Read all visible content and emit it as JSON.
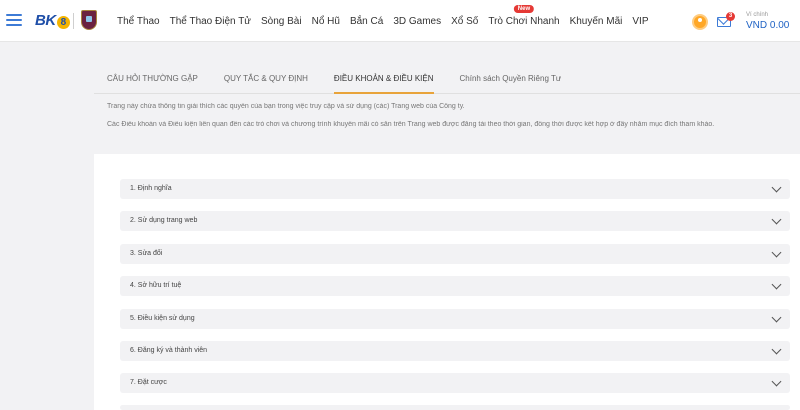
{
  "header": {
    "logo_text": "BK",
    "logo_eight": "8",
    "nav": [
      {
        "label": "Thể Thao"
      },
      {
        "label": "Thể Thao Điện Tử"
      },
      {
        "label": "Sòng Bài"
      },
      {
        "label": "Nổ Hũ"
      },
      {
        "label": "Bắn Cá"
      },
      {
        "label": "3D Games"
      },
      {
        "label": "Xổ Số"
      },
      {
        "label": "Trò Chơi Nhanh",
        "badge": "New"
      },
      {
        "label": "Khuyến Mãi"
      },
      {
        "label": "VIP"
      }
    ],
    "mail_count": "3",
    "balance_label": "Ví chính",
    "balance_value": "VND 0.00"
  },
  "tabs": [
    {
      "label": "CÂU HỎI THƯỜNG GẶP",
      "active": false
    },
    {
      "label": "QUY TẮC & QUY ĐỊNH",
      "active": false
    },
    {
      "label": "ĐIỀU KHOẢN & ĐIỀU KIỆN",
      "active": true
    },
    {
      "label": "Chính sách Quyền Riêng Tư",
      "active": false
    }
  ],
  "intro": {
    "line1": "Trang này chứa thông tin giải thích các quyền của bạn trong việc truy cập và sử dụng (các) Trang web của Công ty.",
    "line2": "Các Điều khoản và Điều kiện liên quan đến các trò chơi và chương trình khuyến mãi có sẵn trên Trang web được đăng tải theo thời gian, đồng thời được kết hợp ở đây nhằm mục đích tham khảo."
  },
  "sections": [
    {
      "label": "1. Định nghĩa"
    },
    {
      "label": "2. Sử dụng trang web"
    },
    {
      "label": "3. Sửa đổi"
    },
    {
      "label": "4. Sở hữu trí tuệ"
    },
    {
      "label": "5. Điều kiện sử dụng"
    },
    {
      "label": "6. Đăng ký và thành viên"
    },
    {
      "label": "7. Đặt cược"
    }
  ],
  "colors": {
    "accent": "#e8a33a",
    "brand_blue": "#3d7bd6",
    "balance": "#1f62c4"
  }
}
